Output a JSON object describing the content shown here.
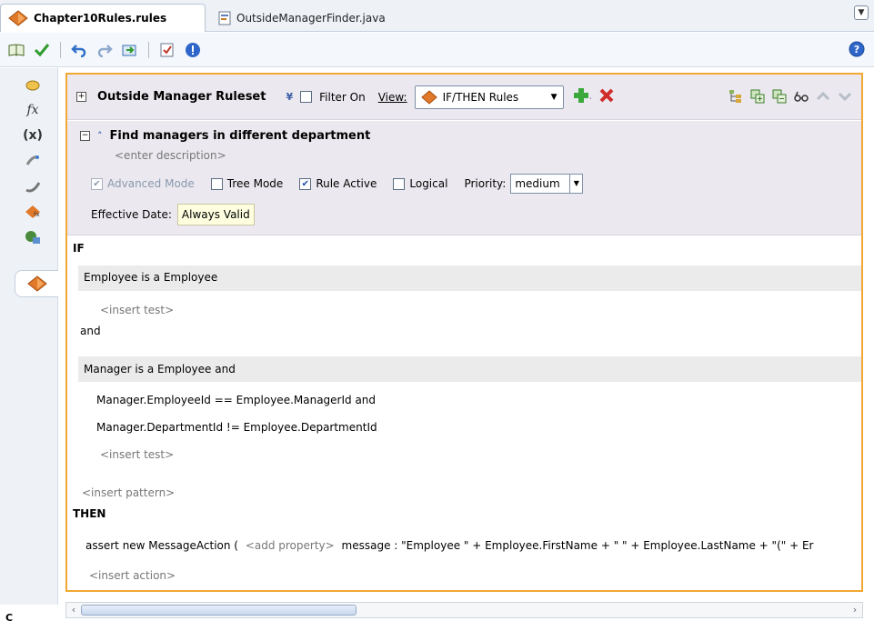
{
  "tabs": [
    {
      "label": "Chapter10Rules.rules",
      "active": true
    },
    {
      "label": "OutsideManagerFinder.java",
      "active": false
    }
  ],
  "ruleset": {
    "title": "Outside Manager Ruleset",
    "filter_label": "Filter On",
    "view_label": "View:",
    "view_value": "IF/THEN Rules"
  },
  "rule": {
    "title": "Find managers in different department",
    "description": "<enter description>",
    "advanced_mode_label": "Advanced Mode",
    "advanced_mode_checked": true,
    "tree_mode_label": "Tree Mode",
    "tree_mode_checked": false,
    "rule_active_label": "Rule Active",
    "rule_active_checked": true,
    "logical_label": "Logical",
    "logical_checked": false,
    "priority_label": "Priority:",
    "priority_value": "medium",
    "effective_date_label": "Effective Date:",
    "effective_date_value": "Always Valid"
  },
  "body": {
    "if_keyword": "IF",
    "pattern1": "Employee is a Employee",
    "insert_test1": "<insert test>",
    "and_keyword": "and",
    "pattern2": "Manager is a Employee  and",
    "test1": "Manager.EmployeeId  ==  Employee.ManagerId and",
    "test2": "Manager.DepartmentId  !=  Employee.DepartmentId",
    "insert_test2": "<insert test>",
    "insert_pattern": "<insert pattern>",
    "then_keyword": "THEN",
    "action_prefix": "assert new MessageAction (",
    "add_property": "<add property>",
    "action_rest": "message : \"Employee \" +  Employee.FirstName + \" \" + Employee.LastName + \"(\" + Er",
    "insert_action": "<insert action>"
  },
  "left_strip": {
    "bottom_label": "C"
  },
  "colors": {
    "accent_border": "#f2a833",
    "header_bg": "#ebe9ef",
    "link_blue": "#1b4fa3"
  },
  "icons": [
    "book-icon",
    "validate-check-icon",
    "undo-icon",
    "redo-icon",
    "import-icon",
    "report-icon",
    "info-icon",
    "help-icon",
    "add-green-icon",
    "delete-red-icon",
    "glasses-icon",
    "move-up-icon",
    "move-down-icon"
  ]
}
